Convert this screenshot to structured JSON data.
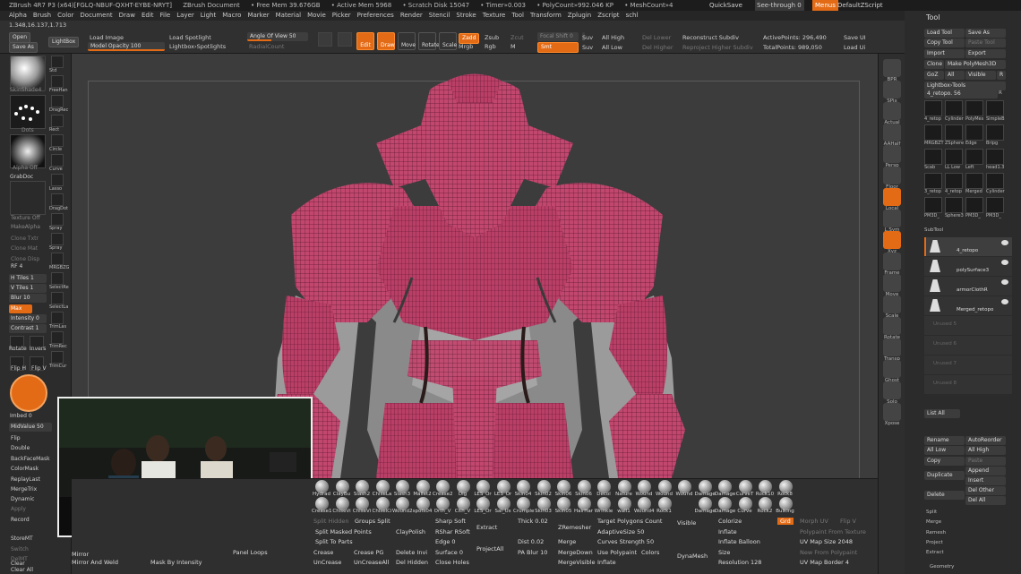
{
  "titlebar": {
    "app": "ZBrush 4R7 P3 (x64)[FGLQ-NBUF-QXHT-EYBE-NRYT]",
    "doc": "ZBrush Document",
    "free_mem": "• Free Mem 39.676GB",
    "active_mem": "• Active Mem 5968",
    "scratch": "• Scratch Disk 15047",
    "timer": "• Timer»0.003",
    "polycount": "• PolyCount»992.046 KP",
    "meshcount": "• MeshCount»4",
    "quicksave": "QuickSave",
    "seethrough": "See-through  0",
    "menus": "Menus",
    "defaultscript": "DefaultZScript"
  },
  "menubar": [
    "Alpha",
    "Brush",
    "Color",
    "Document",
    "Draw",
    "Edit",
    "File",
    "Layer",
    "Light",
    "Macro",
    "Marker",
    "Material",
    "Movie",
    "Picker",
    "Preferences",
    "Render",
    "Stencil",
    "Stroke",
    "Texture",
    "Tool",
    "Transform",
    "Zplugin",
    "Zscript",
    "schl"
  ],
  "coords": "1.348,16.137,1.713",
  "toptool": {
    "open": "Open",
    "save_as": "Save As",
    "lightbox": "LightBox",
    "load_image": "Load Image",
    "model_opacity": "Model Opacity 100",
    "load_spotlight": "Load Spotlight",
    "lightbox_spotlights": "Lightbox›Spotlights",
    "angle_of_view": "Angle Of View 50",
    "radial_count": "RadialCount",
    "edit": "Edit",
    "draw": "Draw",
    "move": "Move",
    "rotate": "Rotate",
    "scale": "Scale",
    "zadd": "Zadd",
    "zsub": "Zsub",
    "zcut": "Zcut",
    "mrgb": "Mrgb",
    "rgb": "Rgb",
    "m": "M",
    "focal_shift": "Focal Shift 0",
    "smt": "Smt",
    "z_intensity": "Z Intensity 25",
    "draw_size": "Draw Size 64",
    "suv": "Suv",
    "rgb_intensity": "Rgb Intensity 100",
    "all_high": "All High",
    "all_low": "All Low",
    "del_lower": "Del Lower",
    "del_higher": "Del Higher",
    "reconstruct_subdiv": "Reconstruct Subdiv",
    "reproject_higher_subdiv": "Reproject Higher Subdiv",
    "active_points": "ActivePoints: 296,490",
    "total_points": "TotalPoints: 989,050",
    "save_ui": "Save UI",
    "load_ui": "Load Ui"
  },
  "lefttray": {
    "material_label": "SkinShade4",
    "alpha_label": "Alpha Off",
    "texture_label": "Texture Off",
    "grabdoc": "GrabDoc",
    "make_alpha": "MakeAlpha",
    "clone_txtr": "Clone Txtr",
    "clone_mat": "Clone Mat",
    "clone_disp": "Clone Disp",
    "rf": "RF 4",
    "h_tiles": "H Tiles 1",
    "v_tiles": "V Tiles 1",
    "blur": "Blur 10",
    "max": "Max",
    "intensity": "Intensity 0",
    "contrast": "Contrast 1",
    "rotate": "Rotate",
    "invers": "Invers",
    "flip_h": "Flip H",
    "flip_v": "Flip V",
    "imbed": "Imbed 0",
    "midvalue": "MidValue 50",
    "flip": "Flip",
    "double": "Double",
    "backfacemask": "BackFaceMask",
    "colormask": "ColorMask",
    "replaylast": "ReplayLast",
    "mergetrix": "MergeTrix",
    "dynamic": "Dynamic",
    "apply": "Apply",
    "record": "Record",
    "storemt": "StoreMT",
    "switch": "Switch",
    "delmt": "DelMT",
    "clear": "Clear",
    "clear_all": "Clear All",
    "brush_icons": [
      "Std",
      "FreeHan",
      "DragRec",
      "Rect",
      "Circle",
      "Curve",
      "Lasso",
      "DragDot",
      "Spray",
      "Spray",
      "MRGBZG",
      "SelectRe",
      "SelectLa",
      "TrimLas",
      "TrimRec",
      "TrimCur"
    ],
    "std_label": "Dots"
  },
  "rightshelf": [
    "BPR",
    "SPix",
    "Actual",
    "AAHalf",
    "Persp",
    "Floor",
    "Local",
    "L.Sym",
    "Xyz",
    "Frame",
    "Move",
    "Scale",
    "Rotate",
    "Transp",
    "Ghost",
    "Solo",
    "Xpose"
  ],
  "toolpal": {
    "title": "Tool",
    "load_tool": "Load Tool",
    "save_as": "Save As",
    "copy_tool": "Copy Tool",
    "paste_tool": "Paste Tool",
    "import": "Import",
    "export": "Export",
    "clone": "Clone",
    "make_polymesh": "Make PolyMesh3D",
    "goz": "GoZ",
    "all": "All",
    "visible": "Visible",
    "r": "R",
    "lightbox_tools": "Lightbox›Tools",
    "current_tool": "4_retopo. 56",
    "tool_thumbs": [
      "4_retop",
      "Cylinder",
      "PolyMes",
      "SimpleB",
      "MRGBZT",
      "ZSphere",
      "Edge",
      "Bripg",
      "Scab",
      "LL Low",
      "Left",
      "head1.3",
      "3_retop",
      "4_retop",
      "Merged",
      "Cylinder",
      "PM3D_",
      "Sphere3",
      "PM3D_",
      "PM3D_"
    ],
    "subtool": "SubTool",
    "subtools": [
      "4_retopo",
      "polySurface3",
      "armorClothR",
      "Merged_retopo",
      "Unused 5",
      "Unused 6",
      "Unused 7",
      "Unused 8"
    ],
    "list_all": "List All",
    "rename": "Rename",
    "autoreorder": "AutoReorder",
    "all_low": "All Low",
    "all_high": "All High",
    "copy": "Copy",
    "paste": "Paste",
    "append": "Append",
    "duplicate": "Duplicate",
    "insert": "Insert",
    "delete": "Delete",
    "del_other": "Del Other",
    "del_all": "Del All",
    "split": "Split",
    "merge": "Merge",
    "remesh": "Remesh",
    "project": "Project",
    "extract": "Extract",
    "geometry": "Geometry"
  },
  "bottom": {
    "brushes": [
      "Hydrad",
      "ClayBu",
      "Slash2",
      "ChiseLa",
      "Slash3",
      "Mallet2",
      "Crease2",
      "Dig",
      "LES_Or",
      "LES_Or",
      "Skin04",
      "Skin02",
      "Skin06",
      "Skin06",
      "Decol",
      "Nature",
      "Wound",
      "Wound",
      "Wound",
      "Damage",
      "Damage",
      "CurveT",
      "Rock10",
      "Rock8"
    ],
    "brushes2": [
      "Crease1",
      "ChiseVi",
      "ChiseVi",
      "ChiselCi",
      "Wound2",
      "spots04",
      "Orth_V",
      "Clth_V",
      "LES_Or",
      "Sal_Us",
      "Crumple",
      "Skin03",
      "Skin05",
      "HairHar",
      "Wrinkle",
      "wall1",
      "Wound4",
      "Rock1",
      "",
      "Damage",
      "Damage",
      "Curve",
      "Rock2",
      "Bulking"
    ],
    "left_col": [
      "Mirror",
      "Mirror And Weld",
      "Crease",
      "UnCrease"
    ],
    "col2": [
      "Mask By Intensity",
      "Crease PG",
      "UnCreaseAll"
    ],
    "panel_loops": "Panel Loops",
    "groups_split": "Groups Split",
    "split_masked": "Split Masked Points",
    "split_to_parts": "Split To Parts",
    "claypolish": "ClayPolish",
    "delete_invi": "Delete Invi",
    "del_hidden": "Del Hidden",
    "sharp_soft": "Sharp Soft",
    "rshar": "RShar RSoft",
    "edge": "Edge 0",
    "surface": "Surface 0",
    "close_holes": "Close Holes",
    "extract": "Extract",
    "project_all": "ProjectAll",
    "thick": "Thick 0.02",
    "dist": "Dist 0.02",
    "pa_blur": "PA Blur 10",
    "zremesher": "ZRemesher",
    "merge": "Merge",
    "mergedown": "MergeDown",
    "mergevisible": "MergeVisible",
    "target_polygons": "Target Polygons Count",
    "adaptive_size": "AdaptiveSize 50",
    "curves_strength": "Curves Strength 50",
    "use_poly": "Use Polypaint",
    "colors": "Colors",
    "inflate": "Inflate",
    "visible": "Visible",
    "dynamesh": "DynaMesh",
    "colorize": "Colorize",
    "inflate2": "Inflate",
    "inflate_balloon": "Inflate Balloon",
    "size": "Size",
    "resolution": "Resolution 128",
    "grd": "Grd",
    "morph_uv": "Morph UV",
    "flip_v": "Flip V",
    "polypaint_from_texture": "Polypaint From Texture",
    "uv_map_size": "UV Map Size 2048",
    "new_from_polypaint": "New From Polypaint",
    "uv_map_border": "UV Map Border 4",
    "x_labels": "X Y Z"
  },
  "colors": {
    "accent": "#e46b16",
    "mesh": "#c2476e",
    "armor_gray": "#9a9a9a"
  }
}
